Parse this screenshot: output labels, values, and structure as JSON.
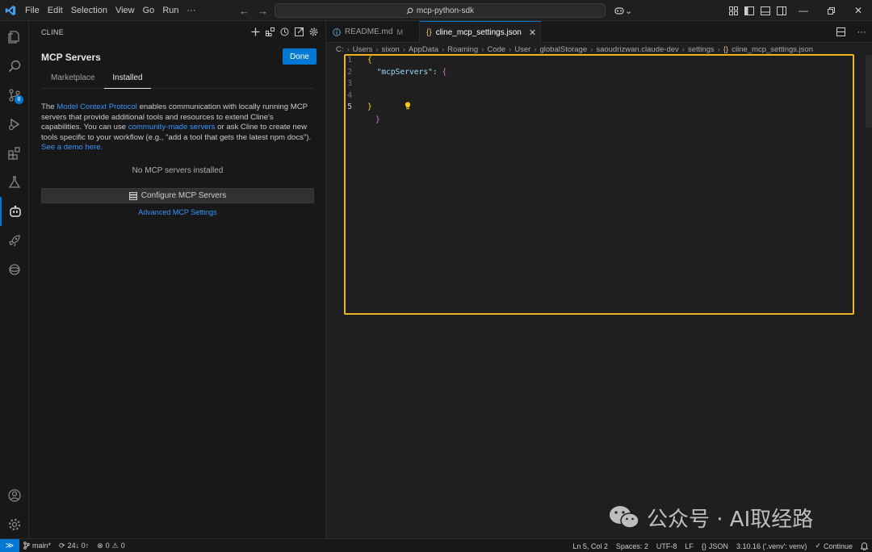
{
  "titlebar": {
    "menus": [
      "File",
      "Edit",
      "Selection",
      "View",
      "Go",
      "Run",
      "···"
    ],
    "search_text": "mcp-python-sdk",
    "copilot_caret": "⌄"
  },
  "activity": {
    "source_control_badge": "8"
  },
  "sidebar": {
    "header": "CLINE",
    "title": "MCP Servers",
    "done_label": "Done",
    "tabs": [
      "Marketplace",
      "Installed"
    ],
    "desc": {
      "part1": "The ",
      "link1": "Model Context Protocol",
      "part2": " enables communication with locally running MCP servers that provide additional tools and resources to extend Cline's capabilities. You can use ",
      "link2": "community-made servers",
      "part3": " or ask Cline to create new tools specific to your workflow (e.g., \"add a tool that gets the latest npm docs\"). ",
      "link3": "See a demo here."
    },
    "empty_message": "No MCP servers installed",
    "configure_label": "Configure MCP Servers",
    "advanced_label": "Advanced MCP Settings"
  },
  "editor": {
    "tabs": [
      {
        "label": "README.md",
        "modifier": "M"
      },
      {
        "label": "cline_mcp_settings.json",
        "icon": "{}"
      }
    ],
    "breadcrumb": [
      "C:",
      "Users",
      "sixon",
      "AppData",
      "Roaming",
      "Code",
      "User",
      "globalStorage",
      "saoudrizwan.claude-dev",
      "settings",
      "cline_mcp_settings.json"
    ],
    "lines": [
      {
        "n": "1",
        "open": "{"
      },
      {
        "n": "2",
        "key": "\"mcpServers\"",
        "sep": ": ",
        "open2": "{"
      },
      {
        "n": "3"
      },
      {
        "n": "4",
        "close2": "}"
      },
      {
        "n": "5",
        "close": "}"
      }
    ]
  },
  "watermark": "公众号 · AI取经路",
  "statusbar": {
    "branch": "main*",
    "sync": "24↓ 0↑",
    "problems_errors": "0",
    "problems_warnings": "0",
    "position": "Ln 5, Col 2",
    "spaces": "Spaces: 2",
    "encoding": "UTF-8",
    "eol": "LF",
    "language": "JSON",
    "interpreter": "3.10.16 ('.venv': venv)",
    "continue": "Continue"
  },
  "colors": {
    "accent": "#0078d4",
    "highlight_box": "#f0b41e",
    "link": "#3794ff"
  }
}
